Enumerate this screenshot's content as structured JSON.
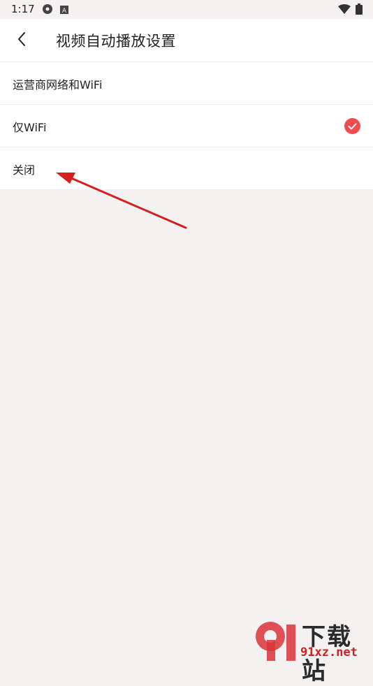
{
  "statusbar": {
    "time": "1:17"
  },
  "header": {
    "title": "视频自动播放设置"
  },
  "options": [
    {
      "label": "运营商网络和WiFi",
      "selected": false
    },
    {
      "label": "仅WiFi",
      "selected": true
    },
    {
      "label": "关闭",
      "selected": false
    }
  ],
  "watermark": {
    "brand_cn": "下载站",
    "url": "91xz.net"
  },
  "colors": {
    "accent": "#f04b4f",
    "background": "#f3f2f1",
    "annotation": "#d61f1f"
  }
}
